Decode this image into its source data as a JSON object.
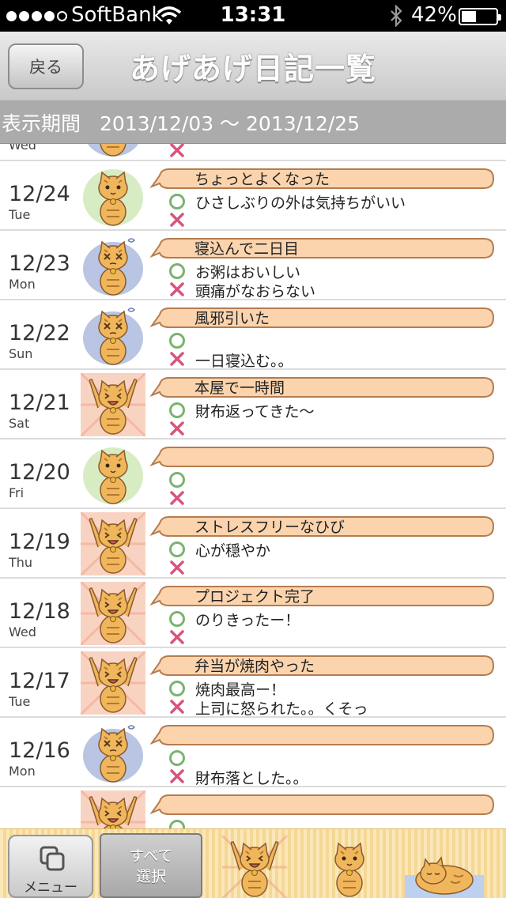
{
  "status_bar": {
    "carrier": "SoftBank",
    "signal_bars": 4,
    "time": "13:31",
    "battery_percent": "42%",
    "battery_level": 0.42
  },
  "nav": {
    "back_label": "戻る",
    "title": "あげあげ日記一覧"
  },
  "period": {
    "label": "表示期間",
    "range": "2013/12/03 〜 2013/12/25"
  },
  "entries": [
    {
      "date": "",
      "dow": "Wed",
      "mood": "sick",
      "title": "",
      "good": "",
      "bad": ""
    },
    {
      "date": "12/24",
      "dow": "Tue",
      "mood": "calm",
      "title": "ちょっとよくなった",
      "good": "ひさしぶりの外は気持ちがいい",
      "bad": ""
    },
    {
      "date": "12/23",
      "dow": "Mon",
      "mood": "sick",
      "title": "寝込んで二日目",
      "good": "お粥はおいしい",
      "bad": "頭痛がなおらない"
    },
    {
      "date": "12/22",
      "dow": "Sun",
      "mood": "sick",
      "title": "風邪引いた",
      "good": "",
      "bad": "一日寝込む。。"
    },
    {
      "date": "12/21",
      "dow": "Sat",
      "mood": "happy",
      "title": "本屋で一時間",
      "good": "財布返ってきた〜",
      "bad": ""
    },
    {
      "date": "12/20",
      "dow": "Fri",
      "mood": "calm",
      "title": "",
      "good": "",
      "bad": ""
    },
    {
      "date": "12/19",
      "dow": "Thu",
      "mood": "happy",
      "title": "ストレスフリーなひび",
      "good": "心が穏やか",
      "bad": ""
    },
    {
      "date": "12/18",
      "dow": "Wed",
      "mood": "happy",
      "title": "プロジェクト完了",
      "good": "のりきったー！",
      "bad": ""
    },
    {
      "date": "12/17",
      "dow": "Tue",
      "mood": "happy",
      "title": "弁当が焼肉やった",
      "good": "焼肉最高ー！",
      "bad": "上司に怒られた。。くそっ"
    },
    {
      "date": "12/16",
      "dow": "Mon",
      "mood": "sick",
      "title": "",
      "good": "",
      "bad": "財布落とした。。"
    },
    {
      "date": "",
      "dow": "",
      "mood": "happy",
      "title": "",
      "good": "",
      "bad": ""
    }
  ],
  "toolbar": {
    "menu_label": "メニュー",
    "select_all_line1": "すべて",
    "select_all_line2": "選択",
    "filters": [
      {
        "name": "filter-happy-cat-icon",
        "mood": "happy"
      },
      {
        "name": "filter-calm-cat-icon",
        "mood": "calm"
      },
      {
        "name": "filter-sleepy-cat-icon",
        "mood": "sleepy"
      }
    ]
  },
  "colors": {
    "bubble_fill": "#fbd4ae",
    "bubble_stroke": "#b57c4f",
    "good_mark": "#7bb36f",
    "bad_mark": "#d9537a",
    "period_bar": "#ababab",
    "toolbar_bg": "#f8dfa6",
    "cat_body": "#f0b65c"
  },
  "icons": {
    "good": "circle-icon",
    "bad": "cross-icon",
    "menu": "windows-icon",
    "wifi": "wifi-icon",
    "bluetooth": "bluetooth-icon",
    "battery": "battery-icon"
  }
}
